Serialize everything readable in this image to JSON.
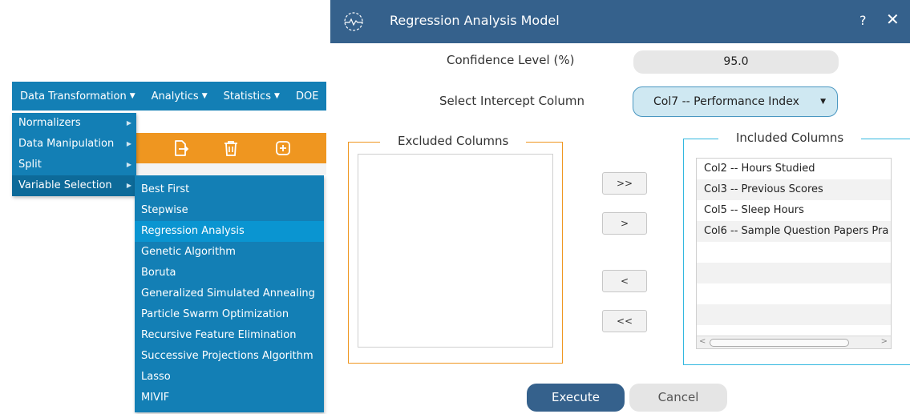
{
  "menubar": {
    "items": [
      {
        "label": "Data Transformation"
      },
      {
        "label": "Analytics"
      },
      {
        "label": "Statistics"
      },
      {
        "label": "DOE"
      }
    ],
    "caret": "▼"
  },
  "submenu_arrow": "▶",
  "menu_data_transformation": {
    "items": [
      {
        "label": "Normalizers"
      },
      {
        "label": "Data Manipulation"
      },
      {
        "label": "Split"
      },
      {
        "label": "Variable Selection"
      }
    ]
  },
  "menu_variable_selection": {
    "items": [
      {
        "label": "Best First"
      },
      {
        "label": "Stepwise"
      },
      {
        "label": "Regression Analysis"
      },
      {
        "label": "Genetic Algorithm"
      },
      {
        "label": "Boruta"
      },
      {
        "label": "Generalized Simulated Annealing"
      },
      {
        "label": "Particle Swarm Optimization"
      },
      {
        "label": "Recursive Feature Elimination"
      },
      {
        "label": "Successive Projections Algorithm"
      },
      {
        "label": "Lasso"
      },
      {
        "label": "MIVIF"
      }
    ]
  },
  "dialog": {
    "title": "Regression Analysis Model",
    "help": "?",
    "close": "✕",
    "confidence_label": "Confidence Level (%)",
    "confidence_value": "95.0",
    "intercept_label": "Select Intercept Column",
    "intercept_value": "Col7 -- Performance Index",
    "dropdown_glyph": "▼",
    "excluded_title": "Excluded Columns",
    "included_title": "Included Columns",
    "included_items": [
      "Col2 -- Hours Studied",
      "Col3 -- Previous Scores",
      "Col5 -- Sleep Hours",
      "Col6 -- Sample Question Papers Pra"
    ],
    "buttons": {
      "add_all": ">>",
      "add": ">",
      "remove": "<",
      "remove_all": "<<",
      "execute": "Execute",
      "cancel": "Cancel"
    },
    "scroll_left": "<",
    "scroll_right": ">"
  },
  "colors": {
    "menu_blue": "#137fb5",
    "toolbar_orange": "#ef9620",
    "title_blue": "#35618c",
    "included_border": "#33b8e0"
  }
}
